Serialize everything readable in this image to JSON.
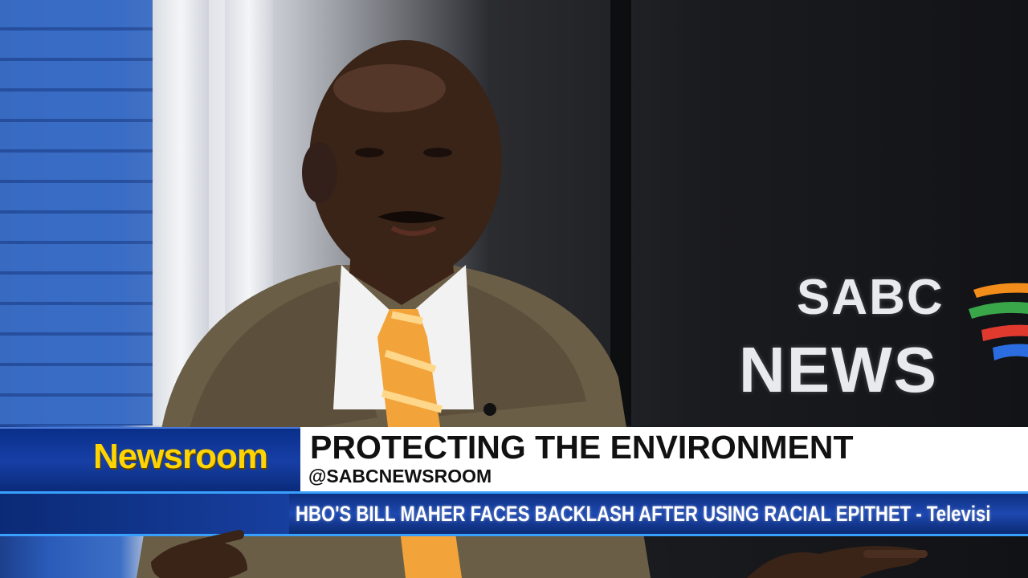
{
  "brand": {
    "label": "Newsroom"
  },
  "logo": {
    "line1": "SABC",
    "line2": "NEWS"
  },
  "lower_third": {
    "headline": "PROTECTING THE ENVIRONMENT",
    "handle": "@SABCNEWSROOM"
  },
  "ticker": {
    "text": "HBO'S BILL MAHER FACES BACKLASH AFTER USING RACIAL EPITHET - Televisi"
  },
  "colors": {
    "brand_yellow": "#ffd400",
    "brand_blue": "#163fa6",
    "ticker_accent": "#3aa0ff"
  }
}
